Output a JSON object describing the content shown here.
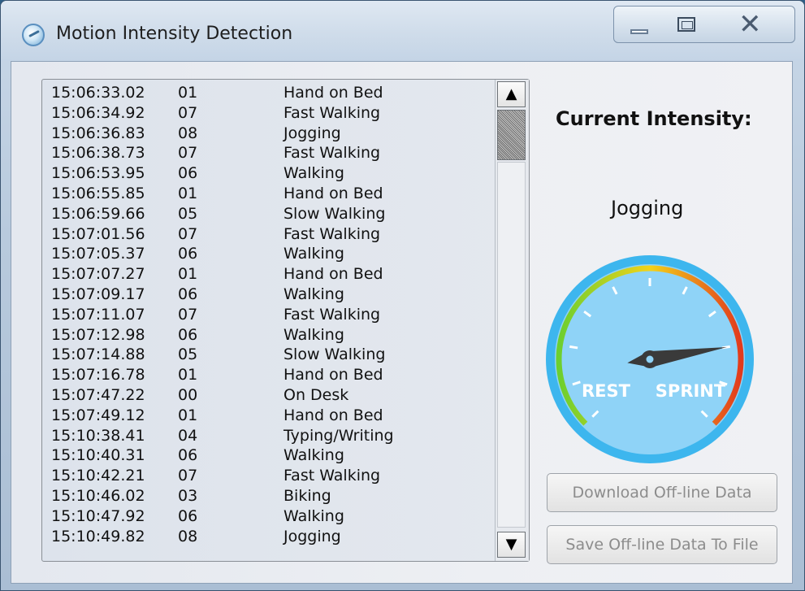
{
  "window": {
    "title": "Motion Intensity Detection",
    "icon": "gauge-app-icon",
    "controls": {
      "minimize": "minimize-icon",
      "maximize": "maximize-icon",
      "close": "close-icon"
    }
  },
  "log": {
    "rows": [
      {
        "time": "15:06:33.02",
        "code": "01",
        "activity": "Hand on Bed"
      },
      {
        "time": "15:06:34.92",
        "code": "07",
        "activity": "Fast Walking"
      },
      {
        "time": "15:06:36.83",
        "code": "08",
        "activity": "Jogging"
      },
      {
        "time": "15:06:38.73",
        "code": "07",
        "activity": "Fast Walking"
      },
      {
        "time": "15:06:53.95",
        "code": "06",
        "activity": "Walking"
      },
      {
        "time": "15:06:55.85",
        "code": "01",
        "activity": "Hand on Bed"
      },
      {
        "time": "15:06:59.66",
        "code": "05",
        "activity": "Slow Walking"
      },
      {
        "time": "15:07:01.56",
        "code": "07",
        "activity": "Fast Walking"
      },
      {
        "time": "15:07:05.37",
        "code": "06",
        "activity": "Walking"
      },
      {
        "time": "15:07:07.27",
        "code": "01",
        "activity": "Hand on Bed"
      },
      {
        "time": "15:07:09.17",
        "code": "06",
        "activity": "Walking"
      },
      {
        "time": "15:07:11.07",
        "code": "07",
        "activity": "Fast Walking"
      },
      {
        "time": "15:07:12.98",
        "code": "06",
        "activity": "Walking"
      },
      {
        "time": "15:07:14.88",
        "code": "05",
        "activity": "Slow Walking"
      },
      {
        "time": "15:07:16.78",
        "code": "01",
        "activity": "Hand on Bed"
      },
      {
        "time": "15:07:47.22",
        "code": "00",
        "activity": "On Desk"
      },
      {
        "time": "15:07:49.12",
        "code": "01",
        "activity": "Hand on Bed"
      },
      {
        "time": "15:10:38.41",
        "code": "04",
        "activity": "Typing/Writing"
      },
      {
        "time": "15:10:40.31",
        "code": "06",
        "activity": "Walking"
      },
      {
        "time": "15:10:42.21",
        "code": "07",
        "activity": "Fast Walking"
      },
      {
        "time": "15:10:46.02",
        "code": "03",
        "activity": "Biking"
      },
      {
        "time": "15:10:47.92",
        "code": "06",
        "activity": "Walking"
      },
      {
        "time": "15:10:49.82",
        "code": "08",
        "activity": "Jogging"
      }
    ],
    "scroll": {
      "up": "▲",
      "down": "▼"
    }
  },
  "intensity": {
    "label": "Current Intensity:",
    "value": "Jogging",
    "gauge": {
      "min_label": "REST",
      "max_label": "SPRINT",
      "level": 0.8,
      "colors": {
        "face": "#8fd3f7",
        "rim": "#3db6ee",
        "green": "#6ccf2f",
        "yellow": "#f2d21a",
        "red": "#e23a1c",
        "needle": "#3a3a3a"
      }
    }
  },
  "actions": {
    "download_label": "Download Off-line Data",
    "save_label": "Save Off-line Data To File"
  }
}
